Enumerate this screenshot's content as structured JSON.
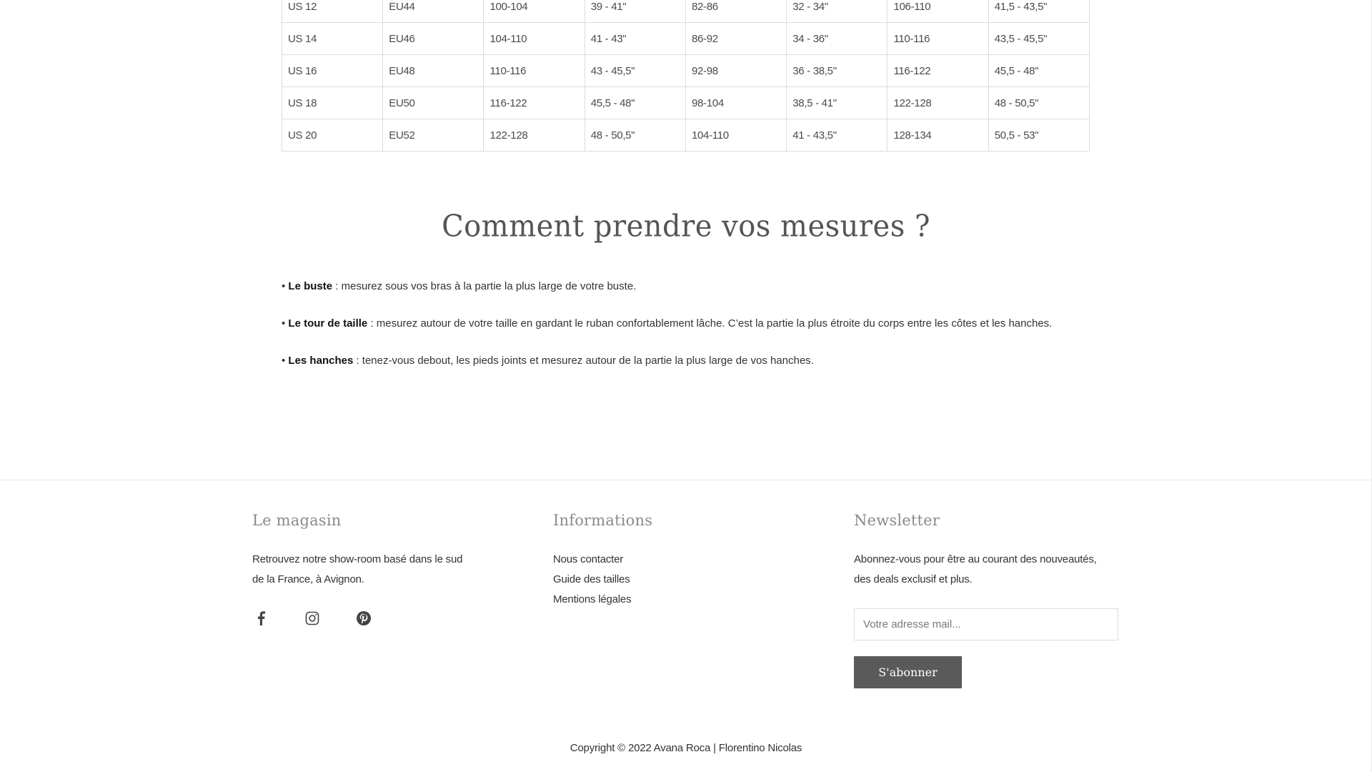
{
  "size_table": {
    "rows": [
      [
        "US 12",
        "EU44",
        "100-104",
        "39 - 41\"",
        "82-86",
        "32 - 34\"",
        "106-110",
        "41,5 - 43,5\""
      ],
      [
        "US 14",
        "EU46",
        "104-110",
        "41 - 43\"",
        "86-92",
        "34 - 36\"",
        "110-116",
        "43,5 - 45,5\""
      ],
      [
        "US 16",
        "EU48",
        "110-116",
        "43 - 45,5\"",
        "92-98",
        "36 - 38,5\"",
        "116-122",
        "45,5 - 48\""
      ],
      [
        "US 18",
        "EU50",
        "116-122",
        "45,5 - 48\"",
        "98-104",
        "38,5 - 41\"",
        "122-128",
        "48 - 50,5\""
      ],
      [
        "US 20",
        "EU52",
        "122-128",
        "48 - 50,5\"",
        "104-110",
        "41 - 43,5\"",
        "128-134",
        "50,5 - 53\""
      ]
    ]
  },
  "measures": {
    "title": "Comment prendre vos mesures ?",
    "items": [
      {
        "bullet": "• ",
        "label": "Le buste",
        "text": " : mesurez sous vos bras à la partie la plus large de votre buste."
      },
      {
        "bullet": "• ",
        "label": "Le tour de taille",
        "text": " : mesurez autour de votre taille en gardant le ruban confortablement lâche. C’est la partie la plus étroite du corps entre les côtes et les hanches."
      },
      {
        "bullet": "• ",
        "label": "Les hanches",
        "text": " : tenez-vous debout, les pieds joints et mesurez autour de la partie la plus large de vos hanches."
      }
    ]
  },
  "footer": {
    "store": {
      "heading": "Le magasin",
      "text_line1": "Retrouvez notre show-room basé dans le sud",
      "text_line2": "de la France, à Avignon.",
      "social": [
        "facebook-icon",
        "instagram-icon",
        "pinterest-icon"
      ]
    },
    "info": {
      "heading": "Informations",
      "links": [
        "Nous contacter",
        "Guide des tailles",
        "Mentions légales"
      ]
    },
    "newsletter": {
      "heading": "Newsletter",
      "text_line1": "Abonnez-vous pour être au courant des nouveautés,",
      "text_line2": "des deals exclusif et plus.",
      "placeholder": "Votre adresse mail...",
      "button_label": "S'abonner"
    },
    "copyright": "Copyright © 2022 Avana Roca |  Florentino Nicolas"
  }
}
